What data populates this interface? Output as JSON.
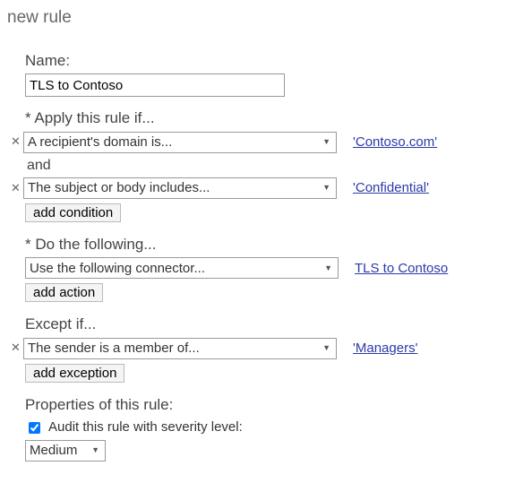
{
  "title": "new rule",
  "name": {
    "label": "Name:",
    "value": "TLS to Contoso"
  },
  "conditions": {
    "label": "* Apply this rule if...",
    "and_label": "and",
    "items": [
      {
        "select": "A recipient's domain is...",
        "value_link": "'Contoso.com'"
      },
      {
        "select": "The subject or body includes...",
        "value_link": "'Confidential'"
      }
    ],
    "add_label": "add condition"
  },
  "actions": {
    "label": "* Do the following...",
    "items": [
      {
        "select": "Use the following connector...",
        "value_link": "TLS to Contoso"
      }
    ],
    "add_label": "add action"
  },
  "exceptions": {
    "label": "Except if...",
    "items": [
      {
        "select": "The sender is a member of...",
        "value_link": "'Managers'"
      }
    ],
    "add_label": "add exception"
  },
  "properties": {
    "label": "Properties of this rule:",
    "audit_label": "Audit this rule with severity level:",
    "audit_checked": true,
    "severity": "Medium"
  }
}
